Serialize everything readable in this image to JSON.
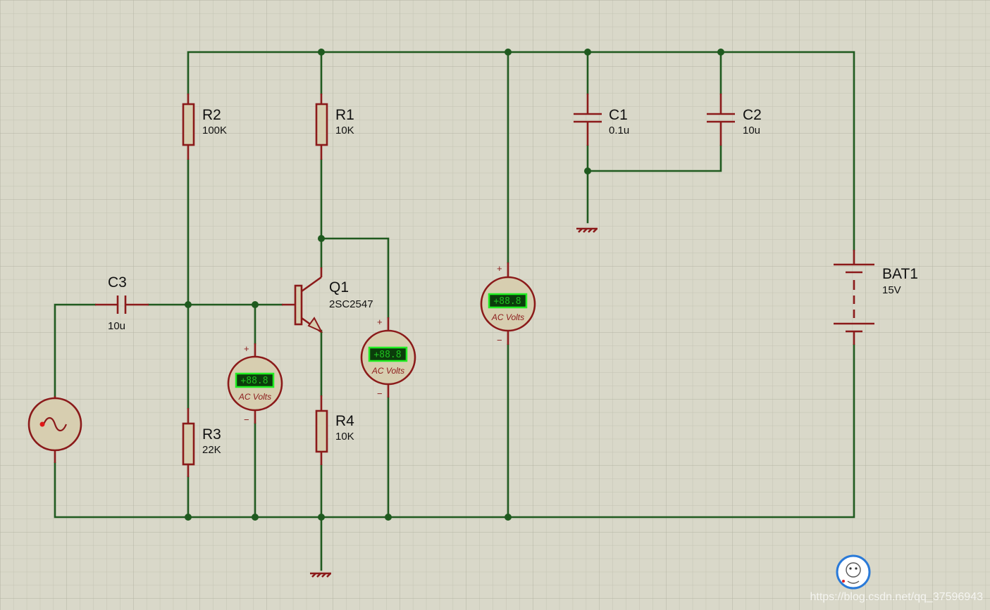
{
  "components": {
    "r1": {
      "ref": "R1",
      "value": "10K"
    },
    "r2": {
      "ref": "R2",
      "value": "100K"
    },
    "r3": {
      "ref": "R3",
      "value": "22K"
    },
    "r4": {
      "ref": "R4",
      "value": "10K"
    },
    "c1": {
      "ref": "C1",
      "value": "0.1u"
    },
    "c2": {
      "ref": "C2",
      "value": "10u"
    },
    "c3": {
      "ref": "C3",
      "value": "10u"
    },
    "q1": {
      "ref": "Q1",
      "value": "2SC2547"
    },
    "bat1": {
      "ref": "BAT1",
      "value": "15V"
    }
  },
  "meters": {
    "reading": "+88.8",
    "label": "AC Volts",
    "plus": "+",
    "minus": "−"
  },
  "watermark": "https://blog.csdn.net/qq_37596943",
  "colors": {
    "background": "#d9d8c9",
    "wire": "#1f5a1f",
    "component": "#8b1a1a",
    "component_fill": "#d7ceb0",
    "lcd": "#0b3d0b",
    "lcd_border": "#22ee22"
  }
}
